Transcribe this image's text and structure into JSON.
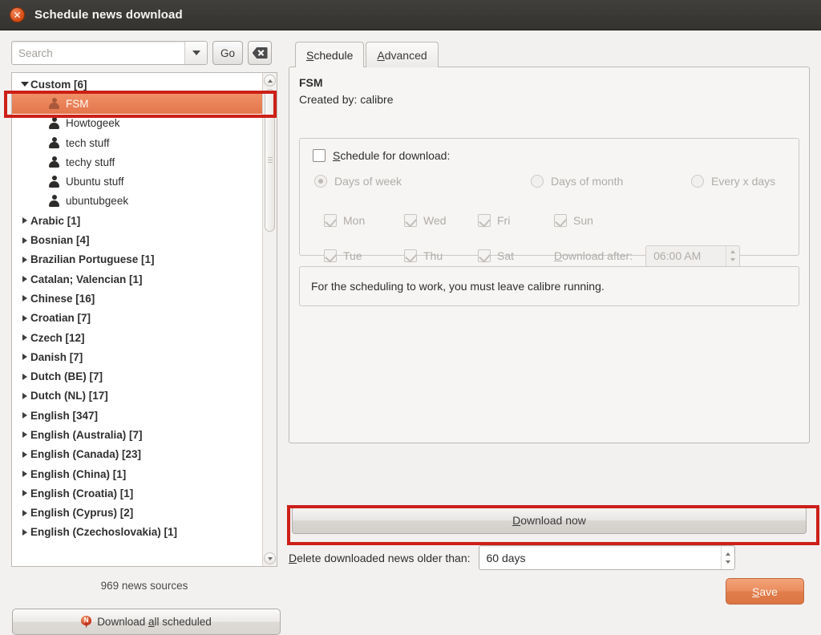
{
  "window": {
    "title": "Schedule news download",
    "close_icon": "close-icon"
  },
  "search": {
    "placeholder": "Search",
    "value": "",
    "dropdown_icon": "chevron-down-icon",
    "go_label": "Go",
    "clear_icon": "clear-search-icon"
  },
  "tree": {
    "nodes": [
      {
        "label": "Custom [6]",
        "type": "group",
        "expanded": true
      },
      {
        "label": "FSM",
        "type": "child",
        "selected": true
      },
      {
        "label": "Howtogeek",
        "type": "child",
        "selected": false
      },
      {
        "label": "tech stuff",
        "type": "child",
        "selected": false
      },
      {
        "label": "techy stuff",
        "type": "child",
        "selected": false
      },
      {
        "label": "Ubuntu stuff",
        "type": "child",
        "selected": false
      },
      {
        "label": "ubuntubgeek",
        "type": "child",
        "selected": false
      },
      {
        "label": "Arabic [1]",
        "type": "group",
        "expanded": false
      },
      {
        "label": "Bosnian [4]",
        "type": "group",
        "expanded": false
      },
      {
        "label": "Brazilian Portuguese [1]",
        "type": "group",
        "expanded": false
      },
      {
        "label": "Catalan; Valencian [1]",
        "type": "group",
        "expanded": false
      },
      {
        "label": "Chinese [16]",
        "type": "group",
        "expanded": false
      },
      {
        "label": "Croatian [7]",
        "type": "group",
        "expanded": false
      },
      {
        "label": "Czech [12]",
        "type": "group",
        "expanded": false
      },
      {
        "label": "Danish [7]",
        "type": "group",
        "expanded": false
      },
      {
        "label": "Dutch (BE) [7]",
        "type": "group",
        "expanded": false
      },
      {
        "label": "Dutch (NL) [17]",
        "type": "group",
        "expanded": false
      },
      {
        "label": "English [347]",
        "type": "group",
        "expanded": false
      },
      {
        "label": "English (Australia) [7]",
        "type": "group",
        "expanded": false
      },
      {
        "label": "English (Canada) [23]",
        "type": "group",
        "expanded": false
      },
      {
        "label": "English (China) [1]",
        "type": "group",
        "expanded": false
      },
      {
        "label": "English (Croatia) [1]",
        "type": "group",
        "expanded": false
      },
      {
        "label": "English (Cyprus) [2]",
        "type": "group",
        "expanded": false
      },
      {
        "label": "English (Czechoslovakia) [1]",
        "type": "group",
        "expanded": false
      }
    ]
  },
  "left_footer": {
    "sources_count": "969 news sources",
    "download_all_label": "Download all scheduled",
    "download_all_icon": "news-pin-icon"
  },
  "tabs": [
    {
      "label": "Schedule",
      "active": true
    },
    {
      "label": "Advanced",
      "active": false
    }
  ],
  "recipe": {
    "title": "FSM",
    "created_by": "Created by: calibre"
  },
  "schedule": {
    "enable_label": "Schedule for download:",
    "enabled": false,
    "modes": [
      {
        "label": "Days of week",
        "selected": true
      },
      {
        "label": "Days of month",
        "selected": false
      },
      {
        "label": "Every x days",
        "selected": false
      }
    ],
    "days": [
      {
        "label": "Mon",
        "checked": true
      },
      {
        "label": "Wed",
        "checked": true
      },
      {
        "label": "Fri",
        "checked": true
      },
      {
        "label": "Sun",
        "checked": true
      },
      {
        "label": "Tue",
        "checked": true
      },
      {
        "label": "Thu",
        "checked": true
      },
      {
        "label": "Sat",
        "checked": true
      }
    ],
    "download_after_label": "Download after:",
    "download_after_value": "06:00 AM"
  },
  "note": "For the scheduling to work, you must leave calibre running.",
  "actions": {
    "download_now_label": "Download now",
    "delete_older_label": "Delete downloaded news older than:",
    "delete_older_value": "60 days",
    "save_label": "Save"
  },
  "colors": {
    "titlebar": "#3b3935",
    "selection": "#e8784c",
    "accent": "#dd7543",
    "annotation": "#cc2018"
  }
}
